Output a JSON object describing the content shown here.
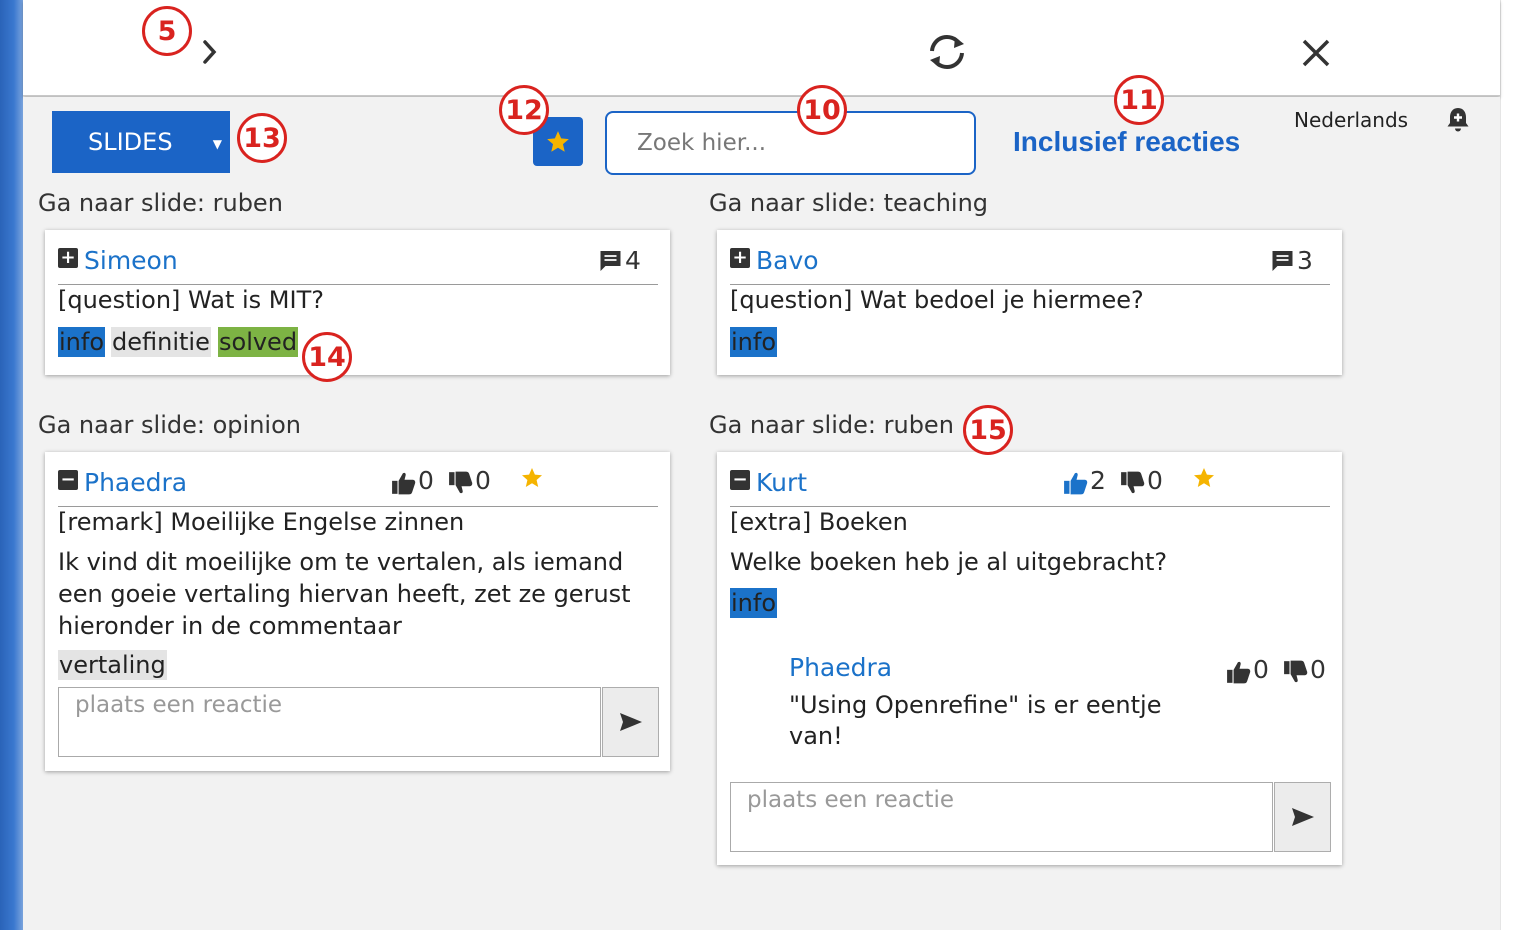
{
  "toolbar": {
    "badge_expand": "5",
    "badge_search": "10",
    "badge_include": "11",
    "badge_star": "12",
    "badge_slides": "13",
    "badge_tags": "14",
    "badge_slide": "15"
  },
  "filters": {
    "slides_label": "SLIDES",
    "search_placeholder": "Zoek hier...",
    "include_reactions": "Inclusief reacties",
    "language": "Nederlands"
  },
  "colors": {
    "accent": "#1b64c6",
    "link": "#1b72c9",
    "star": "#f5b400",
    "tag_info": "#1b72c9",
    "tag_neutral": "#e4e4e4",
    "tag_solved": "#7db344",
    "badge_red": "#d9231f"
  },
  "icons": {
    "expand": "chevron-right-icon",
    "refresh": "refresh-icon",
    "close": "close-icon",
    "bell": "bell-plus-icon",
    "comments": "comment-icon",
    "upvote": "thumbs-up-icon",
    "downvote": "thumbs-down-icon",
    "favorite": "star-icon",
    "send": "send-icon"
  },
  "questions": [
    {
      "slide_link": "Ga naar slide: ruben",
      "toggle": "+",
      "author": "Simeon",
      "comment_count": "4",
      "title": "[question] Wat is MIT?",
      "tags": [
        "info",
        "definitie",
        "solved"
      ]
    },
    {
      "slide_link": "Ga naar slide: teaching",
      "toggle": "+",
      "author": "Bavo",
      "comment_count": "3",
      "title": "[question] Wat bedoel je hiermee?",
      "tags": [
        "info"
      ]
    },
    {
      "slide_link": "Ga naar slide: opinion",
      "toggle": "−",
      "author": "Phaedra",
      "upvotes": "0",
      "downvotes": "0",
      "title": "[remark] Moeilijke Engelse zinnen",
      "body": "Ik vind dit moeilijke om te vertalen, als iemand een goeie vertaling hiervan heeft, zet ze gerust hieronder in de commentaar",
      "tags": [
        "vertaling"
      ],
      "reply_placeholder": "plaats een reactie"
    },
    {
      "slide_link": "Ga naar slide: ruben",
      "toggle": "−",
      "author": "Kurt",
      "upvotes": "2",
      "downvotes": "0",
      "title": "[extra] Boeken",
      "body": "Welke boeken heb je al uitgebracht?",
      "tags": [
        "info"
      ],
      "replies": [
        {
          "author": "Phaedra",
          "upvotes": "0",
          "downvotes": "0",
          "text": "\"Using Openrefine\" is er eentje van!"
        }
      ],
      "reply_placeholder": "plaats een reactie"
    }
  ]
}
